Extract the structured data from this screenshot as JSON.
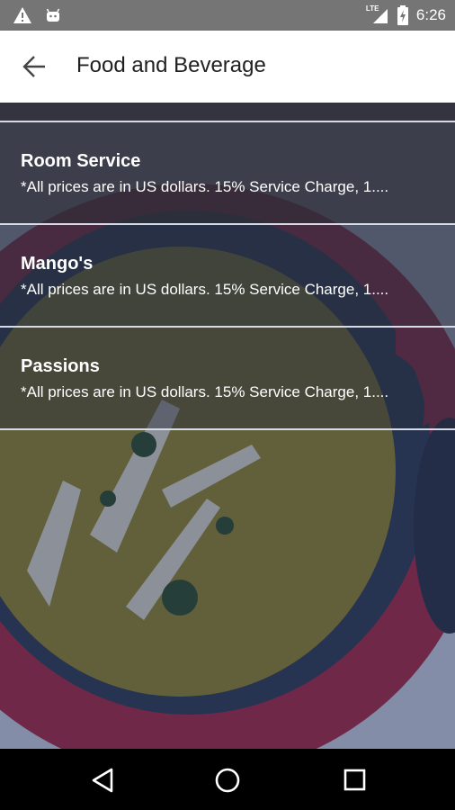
{
  "status_bar": {
    "time": "6:26",
    "network_label": "LTE",
    "icons": [
      "warning-icon",
      "android-icon",
      "signal-icon",
      "battery-charging-icon"
    ]
  },
  "app_bar": {
    "title": "Food and Beverage",
    "back_icon": "arrow-back-icon"
  },
  "restaurants": [
    {
      "name": "Room Service",
      "description": "*All prices are in US dollars. 15% Service Charge, 1...."
    },
    {
      "name": "Mango's",
      "description": "*All prices are in US dollars. 15% Service Charge, 1...."
    },
    {
      "name": "Passions",
      "description": "*All prices are in US dollars. 15% Service Charge, 1...."
    }
  ],
  "nav_bar": {
    "icons": [
      "back-triangle-icon",
      "home-circle-icon",
      "recents-square-icon"
    ]
  },
  "colors": {
    "status_bar": "#757575",
    "app_bar": "#ffffff",
    "overlay": "#1c2c5a",
    "divider": "#d6dbe6"
  }
}
